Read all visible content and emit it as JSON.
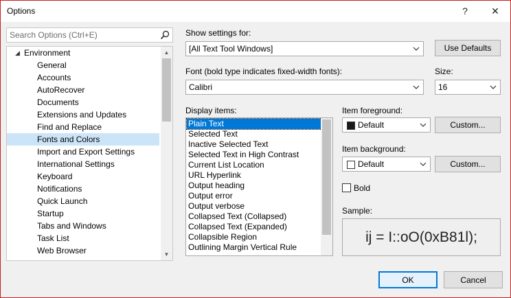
{
  "window": {
    "title": "Options",
    "help_glyph": "?",
    "close_glyph": "✕"
  },
  "search": {
    "placeholder": "Search Options (Ctrl+E)"
  },
  "tree": {
    "items": [
      {
        "label": "Environment",
        "level": 0,
        "expanded": true
      },
      {
        "label": "General",
        "level": 1
      },
      {
        "label": "Accounts",
        "level": 1
      },
      {
        "label": "AutoRecover",
        "level": 1
      },
      {
        "label": "Documents",
        "level": 1
      },
      {
        "label": "Extensions and Updates",
        "level": 1
      },
      {
        "label": "Find and Replace",
        "level": 1
      },
      {
        "label": "Fonts and Colors",
        "level": 1,
        "selected": true
      },
      {
        "label": "Import and Export Settings",
        "level": 1
      },
      {
        "label": "International Settings",
        "level": 1
      },
      {
        "label": "Keyboard",
        "level": 1
      },
      {
        "label": "Notifications",
        "level": 1
      },
      {
        "label": "Quick Launch",
        "level": 1
      },
      {
        "label": "Startup",
        "level": 1
      },
      {
        "label": "Tabs and Windows",
        "level": 1
      },
      {
        "label": "Task List",
        "level": 1
      },
      {
        "label": "Web Browser",
        "level": 1
      }
    ]
  },
  "show_settings": {
    "label": "Show settings for:",
    "value": "[All Text Tool Windows]",
    "use_defaults_label": "Use Defaults"
  },
  "font": {
    "label": "Font (bold type indicates fixed-width fonts):",
    "value": "Calibri"
  },
  "size": {
    "label": "Size:",
    "value": "16"
  },
  "display_items": {
    "label": "Display items:",
    "items": [
      "Plain Text",
      "Selected Text",
      "Inactive Selected Text",
      "Selected Text in High Contrast",
      "Current List Location",
      "URL Hyperlink",
      "Output heading",
      "Output error",
      "Output verbose",
      "Collapsed Text (Collapsed)",
      "Collapsed Text (Expanded)",
      "Collapsible Region",
      "Outlining Margin Vertical Rule"
    ],
    "selected_index": 0
  },
  "item_foreground": {
    "label": "Item foreground:",
    "value": "Default",
    "swatch_color": "#1a1a1a",
    "custom_label": "Custom..."
  },
  "item_background": {
    "label": "Item background:",
    "value": "Default",
    "swatch_color": "#ffffff",
    "custom_label": "Custom..."
  },
  "bold": {
    "label": "Bold",
    "checked": false
  },
  "sample": {
    "label": "Sample:",
    "text": "ij = I::oO(0xB81l);"
  },
  "footer": {
    "ok_label": "OK",
    "cancel_label": "Cancel"
  },
  "colors": {
    "accent": "#0078d7",
    "tree_selection": "#cce4f7",
    "window_border": "#c41e1e"
  }
}
